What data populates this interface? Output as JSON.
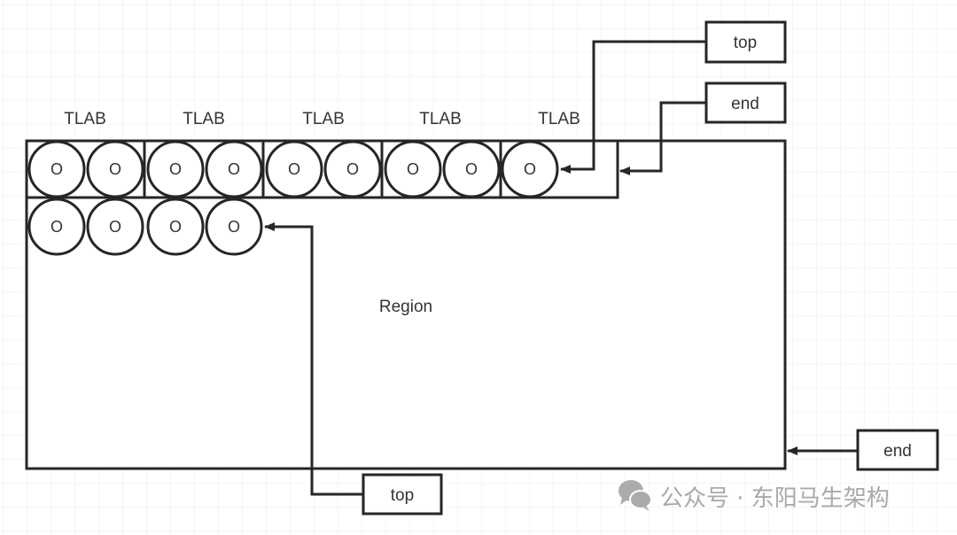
{
  "diagram": {
    "tlab_labels": [
      "TLAB",
      "TLAB",
      "TLAB",
      "TLAB",
      "TLAB"
    ],
    "object_label": "O",
    "region_label": "Region",
    "tlab_top_label": "top",
    "tlab_end_label": "end",
    "region_top_label": "top",
    "region_end_label": "end"
  },
  "watermark": {
    "icon": "wechat-icon",
    "text": "公众号 · 东阳马生架构"
  },
  "colors": {
    "stroke": "#262626",
    "grid": "#e8e8e8",
    "watermark": "#a9a9a9"
  }
}
